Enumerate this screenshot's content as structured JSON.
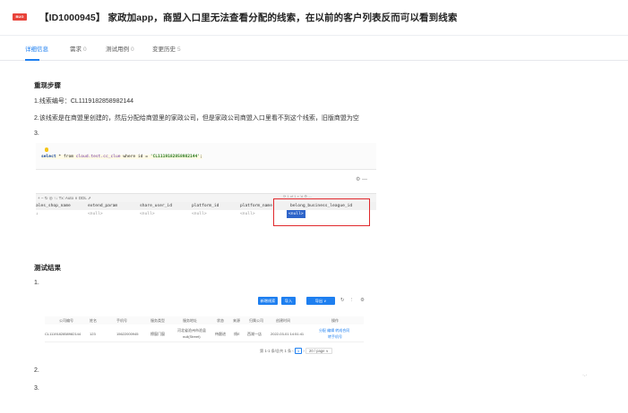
{
  "header": {
    "badge": "BUG",
    "title": "【ID1000945】 家政加app，商盟入口里无法查看分配的线索，在以前的客户列表反而可以看到线索",
    "icons": [
      "star-icon",
      "link-icon"
    ]
  },
  "tabs": [
    {
      "label": "详细信息",
      "count": ""
    },
    {
      "label": "需求",
      "count": "0"
    },
    {
      "label": "测试用例",
      "count": "0"
    },
    {
      "label": "变更历史",
      "count": "5"
    }
  ],
  "reproduce": {
    "heading": "重现步骤",
    "line1": "1.线索编号：CL1119182858982144",
    "line2": "2.该线索是在商盟里创建的，然后分配给商盟里的家政公司，但是家政公司商盟入口里看不到这个线索，旧版商盟为空",
    "line3": "3."
  },
  "sql": {
    "prefix_kw": "select",
    "star_from": " * from ",
    "table": "cloud.test.cc_clue",
    "where": " where id = ",
    "value": "'CL1119182858982144'",
    "suffix": ";",
    "gear": "⚙ —",
    "toolbar": "+  −  ↻  ◎  ↑↓    Tx: Auto ∨    DDL    ⇗",
    "topright": "⟳ 1 of 1   ⌕  ⇲  ⚙  —",
    "columns": [
      "ales_shop_name",
      "extend_param",
      "share_user_id",
      "platform_id",
      "platform_name",
      "belong_business_league_id"
    ],
    "row_values": [
      "↓",
      "<null>",
      "<null>",
      "<null>",
      "<null>",
      "<null>"
    ]
  },
  "result": {
    "heading": "测试结果",
    "item1": "1.",
    "item2": "2.",
    "item3": "3.",
    "buttons": [
      "新增线索",
      "导入",
      "导出"
    ],
    "export_suffix": " ∨",
    "tool_icons": [
      "↻",
      "⫶",
      "⚙"
    ],
    "table_headers": [
      "公司编号",
      "姓名",
      "手机号",
      "服务类型",
      "服务地址",
      "状态",
      "来源",
      "归属公司",
      "创建时间",
      "操作"
    ],
    "row": {
      "id": "CL1119182858982144",
      "name": "123",
      "phone": "15622000945",
      "type": "擦窗门窗",
      "address1": "河北省沧州市沧县",
      "address2": "null(Street)",
      "status": "待跟进",
      "source": "线E",
      "company": "西湖一店",
      "time": "2022-03-01 14:51:41",
      "ops1": "分配  编辑  转成合同",
      "ops2": "转手机号"
    },
    "pager_text": "第 1-1 条/总共 1 条",
    "pager_prev": "‹",
    "pager_current": "1",
    "pager_next": "›",
    "page_size": "20 / page ∨"
  },
  "side_dots": "·.·",
  "colors": {
    "accent": "#1e7ff0",
    "bug": "#e8433a",
    "highlight": "#e0282c"
  }
}
